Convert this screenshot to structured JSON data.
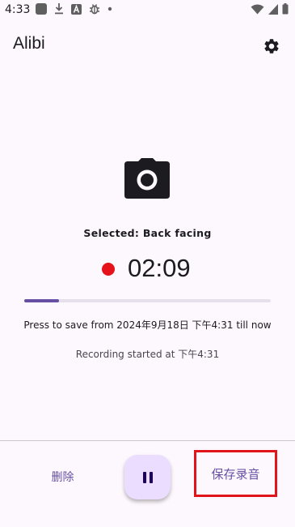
{
  "status_bar": {
    "time": "4:33",
    "left_icons": [
      "notification-square-icon",
      "download-icon",
      "a-badge-icon",
      "bug-icon",
      "dot-icon"
    ],
    "right_icons": [
      "wifi-icon",
      "signal-icon",
      "battery-icon"
    ]
  },
  "app_bar": {
    "title": "Alibi",
    "settings_icon": "gear-icon"
  },
  "recording": {
    "camera_icon": "camera-icon",
    "selected_camera": "Selected: Back facing",
    "timer": "02:09",
    "progress_fraction": 0.14,
    "save_info": "Press to save from 2024年9月18日 下午4:31 till now",
    "started_info": "Recording started at 下午4:31"
  },
  "bottom_bar": {
    "delete_label": "删除",
    "pause_icon": "pause-icon",
    "save_label": "保存录音"
  },
  "colors": {
    "accent": "#6750a4",
    "record_dot": "#e5121c",
    "highlight_border": "#e1141c",
    "pause_bg": "#eaddff",
    "background": "#fdf8fd"
  }
}
